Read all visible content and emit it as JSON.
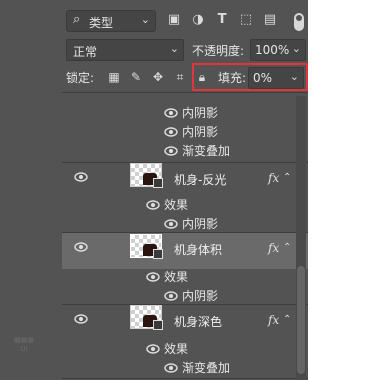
{
  "toolbar": {
    "filter_kind": "类型",
    "filter_icons": [
      "image-filter-icon",
      "adjustment-filter-icon",
      "type-filter-icon",
      "shape-filter-icon",
      "smart-object-filter-icon"
    ]
  },
  "blend": {
    "mode": "正常",
    "opacity_label": "不透明度:",
    "opacity_value": "100%"
  },
  "lock": {
    "label": "锁定:",
    "fill_label": "填充:",
    "fill_value": "0%"
  },
  "top_effects": [
    "内阴影",
    "内阴影",
    "渐变叠加"
  ],
  "layers": [
    {
      "name": "机身-反光",
      "effects_label": "效果",
      "effects": [
        "内阴影"
      ],
      "selected": false
    },
    {
      "name": "机身体积",
      "effects_label": "效果",
      "effects": [
        "内阴影"
      ],
      "selected": true
    },
    {
      "name": "机身深色",
      "effects_label": "效果",
      "effects": [
        "渐变叠加"
      ],
      "selected": false
    }
  ],
  "fx_label": "fx",
  "colors": {
    "highlight": "#e0353b",
    "panel": "#535353",
    "selected_row": "#6a6a6a"
  }
}
